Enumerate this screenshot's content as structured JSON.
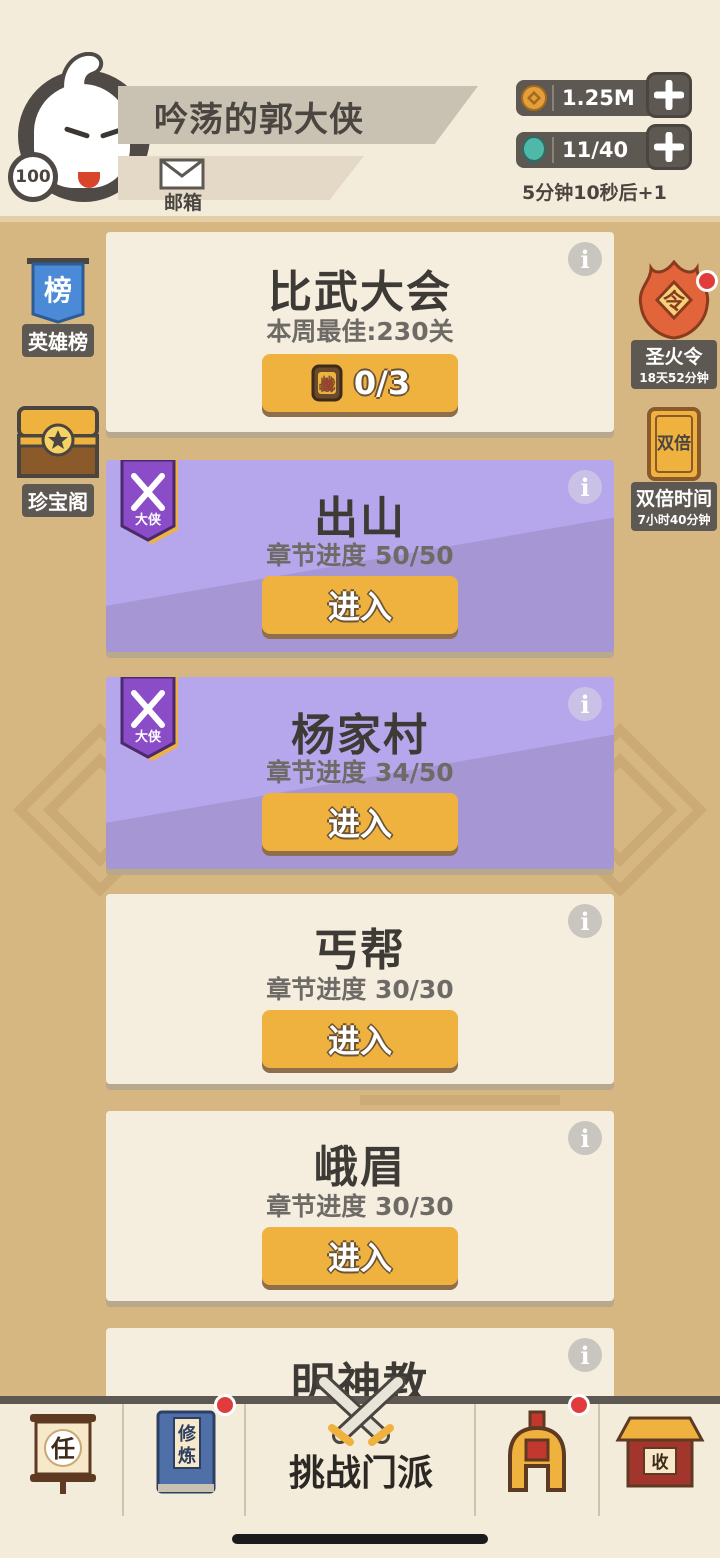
{
  "player": {
    "name": "吟荡的郭大侠",
    "level": "100",
    "mail_label": "邮箱"
  },
  "resources": {
    "coins": "1.25M",
    "energy": "11/40",
    "regen_timer": "5分钟10秒后+1"
  },
  "left_menu": [
    {
      "label": "英雄榜",
      "icon_glyph": "榜"
    },
    {
      "label": "珍宝阁"
    }
  ],
  "right_menu": [
    {
      "label": "圣火令",
      "icon_glyph": "令",
      "sub": "18天52分钟"
    },
    {
      "label": "双倍时间",
      "icon_glyph": "双倍",
      "sub": "7小时40分钟"
    }
  ],
  "tournament": {
    "title": "比武大会",
    "best": "本周最佳:230关",
    "tickets": "0/3",
    "ticket_glyph": "战"
  },
  "enter_label": "进入",
  "rank_badge": "大侠",
  "chapters": [
    {
      "title": "出山",
      "progress": "章节进度 50/50",
      "style": "purple"
    },
    {
      "title": "杨家村",
      "progress": "章节进度 34/50",
      "style": "purple"
    },
    {
      "title": "丐帮",
      "progress": "章节进度 30/30",
      "style": "plain"
    },
    {
      "title": "峨眉",
      "progress": "章节进度 30/30",
      "style": "plain"
    },
    {
      "title": "明神教",
      "progress": "",
      "style": "plain"
    }
  ],
  "bottom_nav": {
    "task_glyph": "任",
    "cultivate_glyph_1": "修",
    "cultivate_glyph_2": "炼",
    "challenge_label": "挑战门派",
    "collect_glyph": "收"
  },
  "colors": {
    "background": "#d6b782",
    "card": "#f5eedf",
    "card_purple": "#a696d4",
    "button": "#f0b23f",
    "dark": "#5e5852",
    "notify": "#e23b3b"
  }
}
